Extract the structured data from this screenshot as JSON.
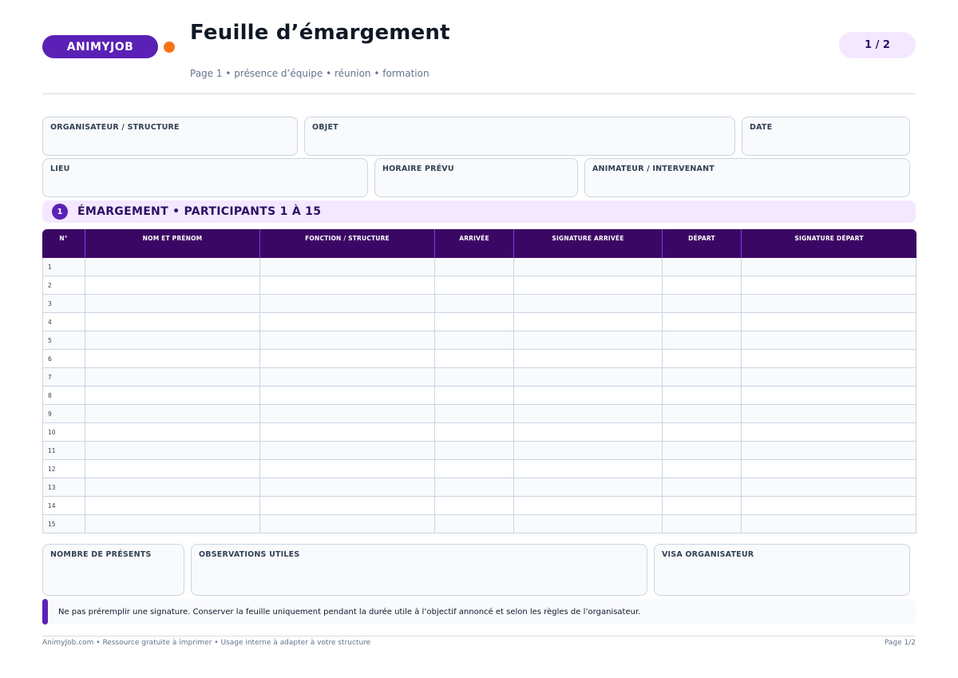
{
  "header": {
    "brand": "ANIMYJOB",
    "title": "Feuille d’émargement",
    "subtitle": "Page 1 • présence d’équipe • réunion • formation",
    "page_indicator": "1 / 2"
  },
  "fields_row1": [
    {
      "label": "ORGANISATEUR / STRUCTURE",
      "value": ""
    },
    {
      "label": "OBJET",
      "value": ""
    },
    {
      "label": "DATE",
      "value": ""
    }
  ],
  "fields_row2": [
    {
      "label": "LIEU",
      "value": ""
    },
    {
      "label": "HORAIRE PRÉVU",
      "value": ""
    },
    {
      "label": "ANIMATEUR / INTERVENANT",
      "value": ""
    }
  ],
  "section": {
    "number": "1",
    "title": "ÉMARGEMENT • PARTICIPANTS 1 À 15"
  },
  "table": {
    "columns": [
      "N°",
      "NOM ET PRÉNOM",
      "FONCTION / STRUCTURE",
      "ARRIVÉE",
      "SIGNATURE ARRIVÉE",
      "DÉPART",
      "SIGNATURE DÉPART"
    ],
    "rows": [
      "1",
      "2",
      "3",
      "4",
      "5",
      "6",
      "7",
      "8",
      "9",
      "10",
      "11",
      "12",
      "13",
      "14",
      "15"
    ]
  },
  "bottom_fields": [
    {
      "label": "NOMBRE DE PRÉSENTS",
      "value": ""
    },
    {
      "label": "OBSERVATIONS UTILES",
      "value": ""
    },
    {
      "label": "VISA ORGANISATEUR",
      "value": ""
    }
  ],
  "note": "Ne pas préremplir une signature. Conserver la feuille uniquement pendant la durée utile à l’objectif annoncé et selon les règles de l’organisateur.",
  "footer": {
    "left": "AnimyJob.com  •  Ressource gratuite à imprimer  •  Usage interne à adapter à votre structure",
    "right": "Page 1/2"
  },
  "colors": {
    "brand": "#5b21b6",
    "accent": "#f97316",
    "table_header": "#3b0764",
    "section_bg": "#f3e8ff"
  }
}
